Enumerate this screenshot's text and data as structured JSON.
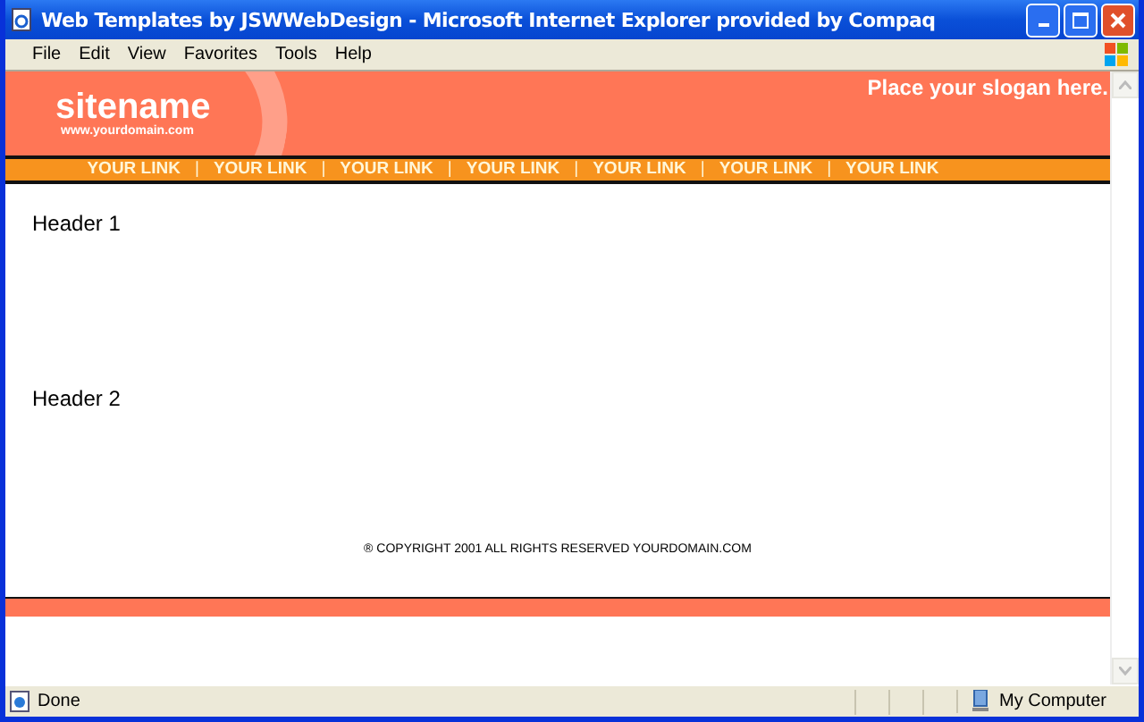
{
  "window": {
    "title": "Web Templates by JSWWebDesign - Microsoft Internet Explorer provided by Compaq"
  },
  "menu": [
    "File",
    "Edit",
    "View",
    "Favorites",
    "Tools",
    "Help"
  ],
  "page": {
    "sitename": "sitename",
    "domain": "www.yourdomain.com",
    "slogan": "Place your slogan here.",
    "nav": [
      "YOUR LINK",
      "YOUR LINK",
      "YOUR LINK",
      "YOUR LINK",
      "YOUR LINK",
      "YOUR LINK",
      "YOUR LINK"
    ],
    "nav_separator": "|",
    "headers": [
      "Header 1",
      "Header 2"
    ],
    "copyright": "® COPYRIGHT 2001 ALL RIGHTS RESERVED YOURDOMAIN.COM"
  },
  "status_bar": {
    "status": "Done",
    "zone": "My Computer"
  }
}
